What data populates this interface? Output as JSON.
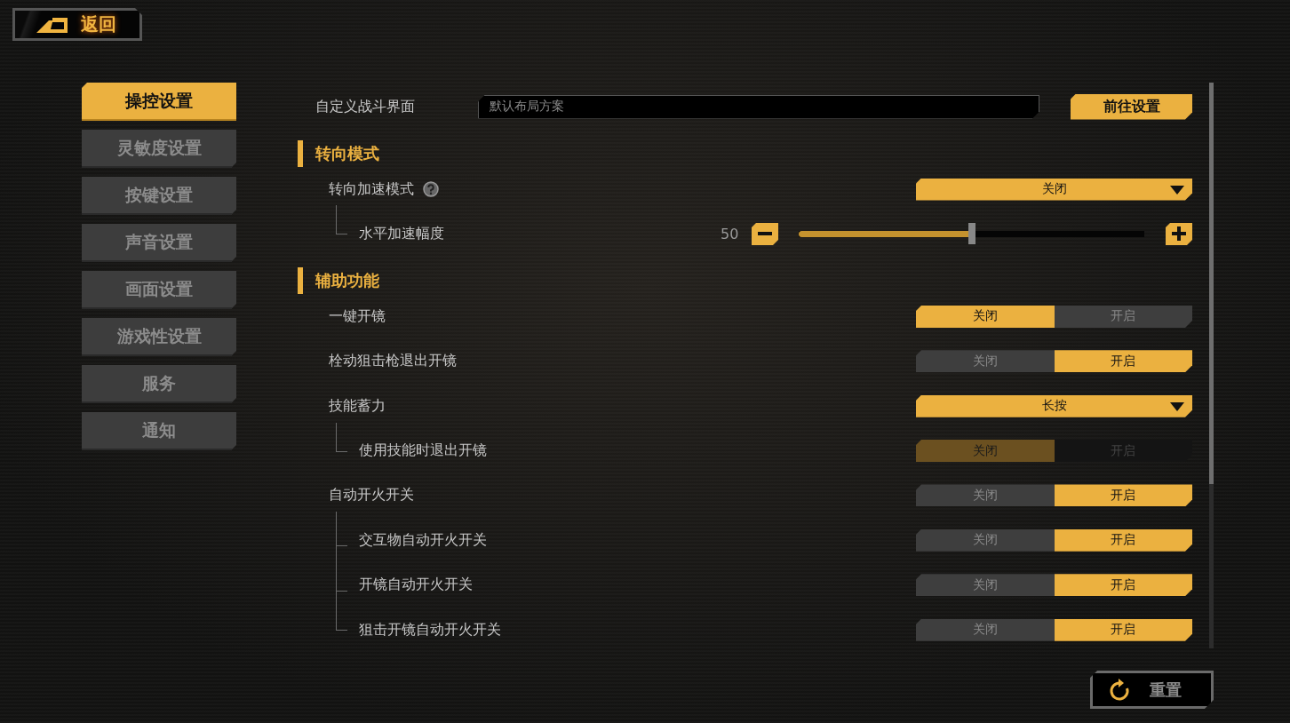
{
  "back_button": {
    "label": "返回"
  },
  "sidebar": {
    "items": [
      {
        "label": "操控设置",
        "selected": true
      },
      {
        "label": "灵敏度设置",
        "selected": false
      },
      {
        "label": "按键设置",
        "selected": false
      },
      {
        "label": "声音设置",
        "selected": false
      },
      {
        "label": "画面设置",
        "selected": false
      },
      {
        "label": "游戏性设置",
        "selected": false
      },
      {
        "label": "服务",
        "selected": false
      },
      {
        "label": "通知",
        "selected": false
      }
    ]
  },
  "settings": [
    {
      "kind": "field",
      "label": "自定义战斗界面",
      "value": "默认布局方案",
      "button": "前往设置"
    },
    {
      "kind": "section",
      "title": "转向模式"
    },
    {
      "kind": "dropdown",
      "label": "转向加速模式",
      "help": true,
      "value": "关闭",
      "children": [
        {
          "kind": "slider",
          "label": "水平加速幅度",
          "value": "50",
          "level": 0.5
        }
      ]
    },
    {
      "kind": "section",
      "title": "辅助功能"
    },
    {
      "kind": "toggle",
      "label": "一键开镜",
      "disabled": false,
      "options": [
        {
          "label": "关闭",
          "selected": true
        },
        {
          "label": "开启",
          "selected": false
        }
      ]
    },
    {
      "kind": "toggle",
      "label": "栓动狙击枪退出开镜",
      "disabled": false,
      "options": [
        {
          "label": "关闭",
          "selected": false
        },
        {
          "label": "开启",
          "selected": true
        }
      ]
    },
    {
      "kind": "dropdown",
      "label": "技能蓄力",
      "help": false,
      "value": "长按",
      "children": [
        {
          "kind": "toggle",
          "label": "使用技能时退出开镜",
          "disabled": true,
          "options": [
            {
              "label": "关闭",
              "selected": true
            },
            {
              "label": "开启",
              "selected": false
            }
          ]
        }
      ]
    },
    {
      "kind": "toggle",
      "label": "自动开火开关",
      "disabled": false,
      "options": [
        {
          "label": "关闭",
          "selected": false
        },
        {
          "label": "开启",
          "selected": true
        }
      ],
      "children": [
        {
          "kind": "toggle",
          "label": "交互物自动开火开关",
          "disabled": false,
          "options": [
            {
              "label": "关闭",
              "selected": false
            },
            {
              "label": "开启",
              "selected": true
            }
          ]
        },
        {
          "kind": "toggle",
          "label": "开镜自动开火开关",
          "disabled": false,
          "options": [
            {
              "label": "关闭",
              "selected": false
            },
            {
              "label": "开启",
              "selected": true
            }
          ]
        },
        {
          "kind": "toggle",
          "label": "狙击开镜自动开火开关",
          "disabled": false,
          "options": [
            {
              "label": "关闭",
              "selected": false
            },
            {
              "label": "开启",
              "selected": true
            }
          ]
        }
      ]
    }
  ],
  "reset_button": {
    "label": "重置"
  }
}
